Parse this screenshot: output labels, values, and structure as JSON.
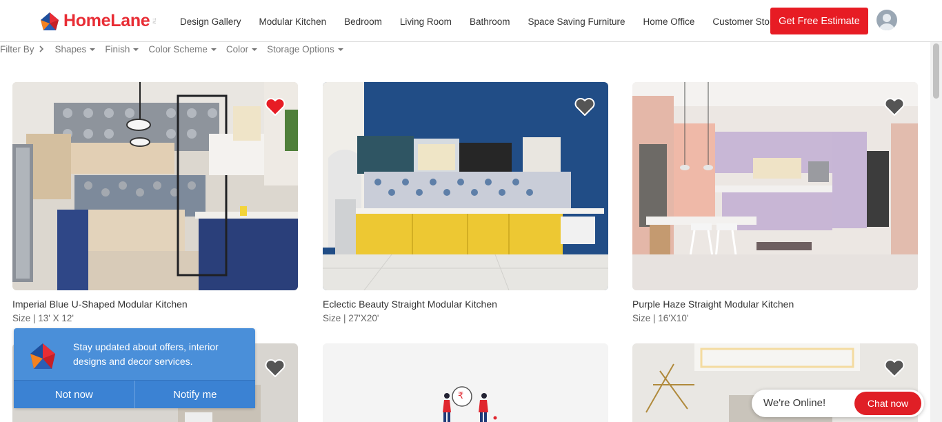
{
  "brand": {
    "name": "HomeLane",
    "tm": "TM",
    "color": "#e82d35"
  },
  "nav": {
    "items": [
      "Design Gallery",
      "Modular Kitchen",
      "Bedroom",
      "Living Room",
      "Bathroom",
      "Space Saving Furniture",
      "Home Office",
      "Customer Stories"
    ],
    "cta_label": "Get Free Estimate",
    "cta_color": "#e71c24",
    "avatar_icon": "user-avatar-icon"
  },
  "filters": {
    "label": "Filter By",
    "options": [
      "Shapes",
      "Finish",
      "Color Scheme",
      "Color",
      "Storage Options"
    ]
  },
  "cards": [
    {
      "title": "Imperial Blue U-Shaped Modular Kitchen",
      "size": "Size | 13' X 12'",
      "favorited": true
    },
    {
      "title": "Eclectic Beauty Straight Modular Kitchen",
      "size": "Size | 27'X20'",
      "favorited": false
    },
    {
      "title": "Purple Haze Straight Modular Kitchen",
      "size": "Size | 16'X10'",
      "favorited": false
    }
  ],
  "notification": {
    "message": "Stay updated about offers, interior designs and decor services.",
    "dismiss_label": "Not now",
    "accept_label": "Notify me",
    "bg_color": "#4a8fd9"
  },
  "chat": {
    "status_text": "We're Online!",
    "button_label": "Chat now",
    "button_color": "#e01f26"
  },
  "rupee_symbol": "₹"
}
